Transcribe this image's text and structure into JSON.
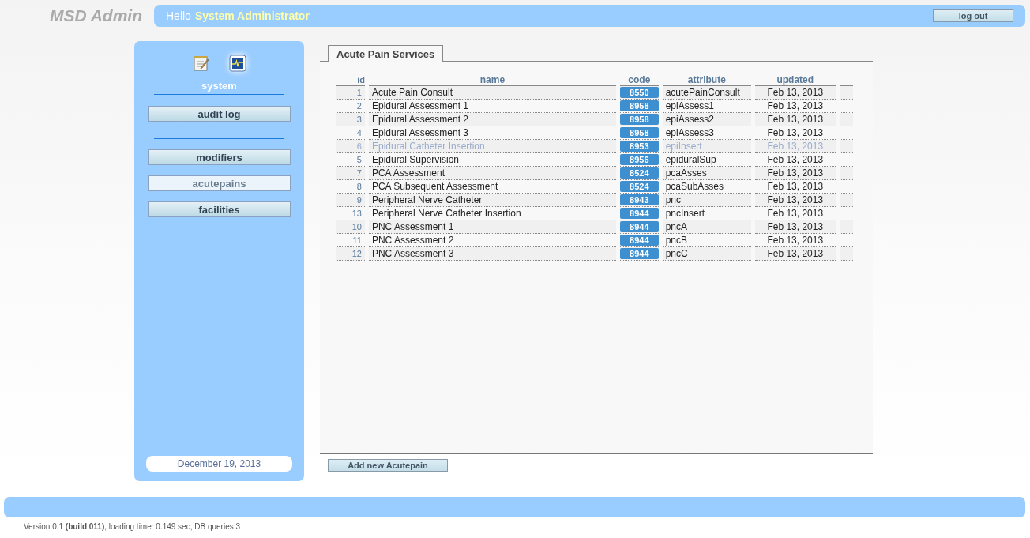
{
  "header": {
    "logo": "MSD Admin",
    "greeting": "Hello",
    "user": "System Administrator",
    "logout": "log out"
  },
  "sidebar": {
    "modules": [
      {
        "kind": "notepad",
        "selected": false
      },
      {
        "kind": "monitor",
        "selected": true
      }
    ],
    "module_label": "system",
    "items": [
      {
        "label": "audit log",
        "selected": false,
        "divider_after": true
      },
      {
        "label": "modifiers",
        "selected": false,
        "divider_after": false
      },
      {
        "label": "acutepains",
        "selected": true,
        "divider_after": false
      },
      {
        "label": "facilities",
        "selected": false,
        "divider_after": false
      }
    ],
    "date": "December 19, 2013"
  },
  "tabs": [
    {
      "label": "Acute Pain Services",
      "selected": true
    }
  ],
  "table": {
    "columns": [
      "id",
      "name",
      "code",
      "attribute",
      "updated"
    ],
    "rows": [
      {
        "id": "1",
        "name": "Acute Pain Consult",
        "code": "8550",
        "attribute": "acutePainConsult",
        "updated": "Feb 13, 2013",
        "disabled": false
      },
      {
        "id": "2",
        "name": "Epidural Assessment 1",
        "code": "8958",
        "attribute": "epiAssess1",
        "updated": "Feb 13, 2013",
        "disabled": false
      },
      {
        "id": "3",
        "name": "Epidural Assessment 2",
        "code": "8958",
        "attribute": "epiAssess2",
        "updated": "Feb 13, 2013",
        "disabled": false
      },
      {
        "id": "4",
        "name": "Epidural Assessment 3",
        "code": "8958",
        "attribute": "epiAssess3",
        "updated": "Feb 13, 2013",
        "disabled": false
      },
      {
        "id": "6",
        "name": "Epidural Catheter Insertion",
        "code": "8953",
        "attribute": "epiInsert",
        "updated": "Feb 13, 2013",
        "disabled": true
      },
      {
        "id": "5",
        "name": "Epidural Supervision",
        "code": "8956",
        "attribute": "epiduralSup",
        "updated": "Feb 13, 2013",
        "disabled": false
      },
      {
        "id": "7",
        "name": "PCA Assessment",
        "code": "8524",
        "attribute": "pcaAsses",
        "updated": "Feb 13, 2013",
        "disabled": false
      },
      {
        "id": "8",
        "name": "PCA Subsequent Assessment",
        "code": "8524",
        "attribute": "pcaSubAsses",
        "updated": "Feb 13, 2013",
        "disabled": false
      },
      {
        "id": "9",
        "name": "Peripheral Nerve Catheter",
        "code": "8943",
        "attribute": "pnc",
        "updated": "Feb 13, 2013",
        "disabled": false
      },
      {
        "id": "13",
        "name": "Peripheral Nerve Catheter Insertion",
        "code": "8944",
        "attribute": "pncInsert",
        "updated": "Feb 13, 2013",
        "disabled": false
      },
      {
        "id": "10",
        "name": "PNC Assessment 1",
        "code": "8944",
        "attribute": "pncA",
        "updated": "Feb 13, 2013",
        "disabled": false
      },
      {
        "id": "11",
        "name": "PNC Assessment 2",
        "code": "8944",
        "attribute": "pncB",
        "updated": "Feb 13, 2013",
        "disabled": false
      },
      {
        "id": "12",
        "name": "PNC Assessment 3",
        "code": "8944",
        "attribute": "pncC",
        "updated": "Feb 13, 2013",
        "disabled": false
      }
    ]
  },
  "add_button": "Add new Acutepain",
  "footer": {
    "version": "Version 0.1 **(build 011)**, loading time: 0.149 sec, DB queries 3"
  }
}
